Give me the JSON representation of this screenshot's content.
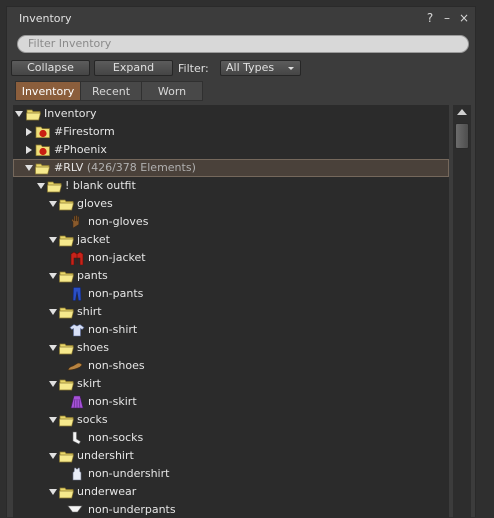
{
  "window": {
    "title": "Inventory",
    "help": "?",
    "minimize": "–",
    "close": "×"
  },
  "search": {
    "placeholder": "Filter Inventory"
  },
  "toolbar": {
    "collapse": "Collapse",
    "expand": "Expand",
    "filter_label": "Filter:",
    "filter_value": "All Types"
  },
  "tabs": [
    {
      "label": "Inventory",
      "active": true
    },
    {
      "label": "Recent"
    },
    {
      "label": "Worn"
    }
  ],
  "tree": {
    "root": "Inventory",
    "firestorm": "#Firestorm",
    "phoenix": "#Phoenix",
    "rlv": "#RLV",
    "rlv_count": "(426/378 Elements)",
    "blank_outfit": "! blank outfit",
    "gloves": "gloves",
    "non_gloves": "non-gloves",
    "jacket": "jacket",
    "non_jacket": "non-jacket",
    "pants": "pants",
    "non_pants": "non-pants",
    "shirt": "shirt",
    "non_shirt": "non-shirt",
    "shoes": "shoes",
    "non_shoes": "non-shoes",
    "skirt": "skirt",
    "non_skirt": "non-skirt",
    "socks": "socks",
    "non_socks": "non-socks",
    "undershirt": "undershirt",
    "non_undershirt": "non-undershirt",
    "underwear": "underwear",
    "non_underpants": "non-underpants"
  },
  "colors": {
    "accent": "#8b5e3c",
    "folder": "#f2e27a",
    "selected_row": "#4a413a"
  }
}
